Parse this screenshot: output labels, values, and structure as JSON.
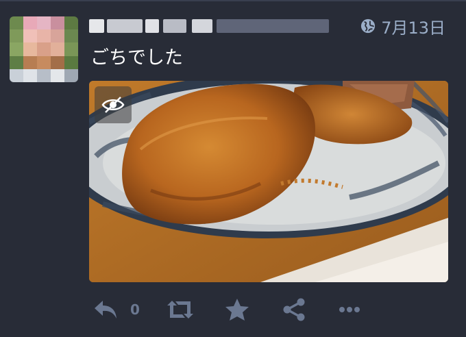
{
  "status": {
    "timestamp": "7月13日",
    "content": "ごちでした",
    "reply_count": "0"
  },
  "colors": {
    "background": "#282c37",
    "meta_text": "#9baec8",
    "action_icon": "#6b7891"
  },
  "icons": {
    "visibility": "globe-icon",
    "media_toggle": "eye-slash-icon",
    "reply": "reply-icon",
    "boost": "retweet-icon",
    "favourite": "star-icon",
    "share": "share-icon",
    "more": "ellipsis-icon"
  }
}
